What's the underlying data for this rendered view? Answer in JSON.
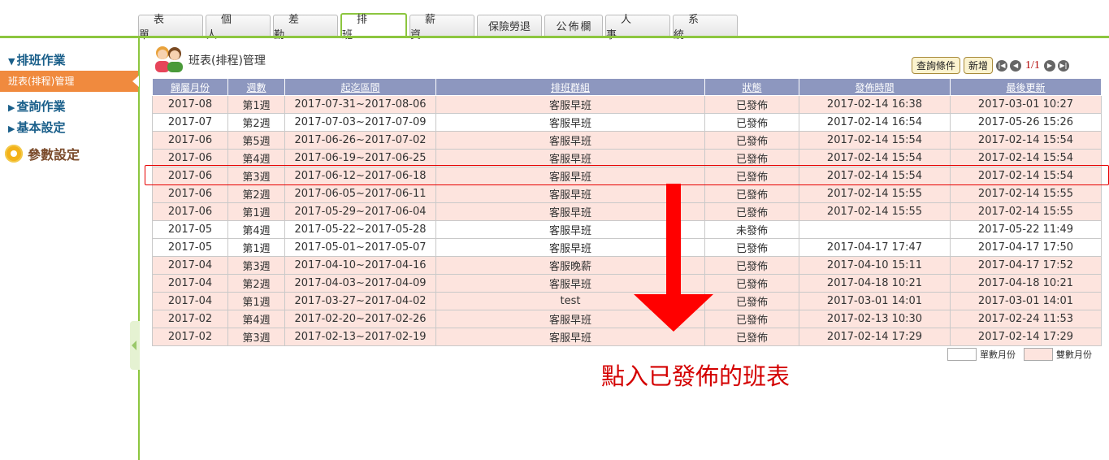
{
  "tabs": [
    "表單",
    "個人",
    "差勤",
    "排班",
    "薪資",
    "保險勞退",
    "公佈欄",
    "人事",
    "系統"
  ],
  "sidebar": {
    "section1": "排班作業",
    "active_item": "班表(排程)管理",
    "section2": "查詢作業",
    "section3": "基本設定",
    "gear_item": "參數設定"
  },
  "page": {
    "title": "班表(排程)管理"
  },
  "toolbar": {
    "query_label": "查詢條件",
    "add_label": "新增",
    "pager": "1/1"
  },
  "table": {
    "columns": [
      "歸屬月份",
      "週數",
      "起迄區間",
      "排班群組",
      "狀態",
      "發佈時間",
      "最後更新"
    ],
    "rows": [
      [
        "2017-08",
        "第1週",
        "2017-07-31~2017-08-06",
        "客服早班",
        "已發佈",
        "2017-02-14 16:38",
        "2017-03-01 10:27"
      ],
      [
        "2017-07",
        "第2週",
        "2017-07-03~2017-07-09",
        "客服早班",
        "已發佈",
        "2017-02-14 16:54",
        "2017-05-26 15:26"
      ],
      [
        "2017-06",
        "第5週",
        "2017-06-26~2017-07-02",
        "客服早班",
        "已發佈",
        "2017-02-14 15:54",
        "2017-02-14 15:54"
      ],
      [
        "2017-06",
        "第4週",
        "2017-06-19~2017-06-25",
        "客服早班",
        "已發佈",
        "2017-02-14 15:54",
        "2017-02-14 15:54"
      ],
      [
        "2017-06",
        "第3週",
        "2017-06-12~2017-06-18",
        "客服早班",
        "已發佈",
        "2017-02-14 15:54",
        "2017-02-14 15:54"
      ],
      [
        "2017-06",
        "第2週",
        "2017-06-05~2017-06-11",
        "客服早班",
        "已發佈",
        "2017-02-14 15:55",
        "2017-02-14 15:55"
      ],
      [
        "2017-06",
        "第1週",
        "2017-05-29~2017-06-04",
        "客服早班",
        "已發佈",
        "2017-02-14 15:55",
        "2017-02-14 15:55"
      ],
      [
        "2017-05",
        "第4週",
        "2017-05-22~2017-05-28",
        "客服早班",
        "未發佈",
        "",
        "2017-05-22 11:49"
      ],
      [
        "2017-05",
        "第1週",
        "2017-05-01~2017-05-07",
        "客服早班",
        "已發佈",
        "2017-04-17 17:47",
        "2017-04-17 17:50"
      ],
      [
        "2017-04",
        "第3週",
        "2017-04-10~2017-04-16",
        "客服晚薪",
        "已發佈",
        "2017-04-10 15:11",
        "2017-04-17 17:52"
      ],
      [
        "2017-04",
        "第2週",
        "2017-04-03~2017-04-09",
        "客服早班",
        "已發佈",
        "2017-04-18 10:21",
        "2017-04-18 10:21"
      ],
      [
        "2017-04",
        "第1週",
        "2017-03-27~2017-04-02",
        "test",
        "已發佈",
        "2017-03-01 14:01",
        "2017-03-01 14:01"
      ],
      [
        "2017-02",
        "第4週",
        "2017-02-20~2017-02-26",
        "客服早班",
        "已發佈",
        "2017-02-13 10:30",
        "2017-02-24 11:53"
      ],
      [
        "2017-02",
        "第3週",
        "2017-02-13~2017-02-19",
        "客服早班",
        "已發佈",
        "2017-02-14 17:29",
        "2017-02-14 17:29"
      ]
    ]
  },
  "legend": {
    "odd": "單數月份",
    "even": "雙數月份"
  },
  "annotation": {
    "text": "點入已發佈的班表"
  },
  "colors": {
    "accent_green": "#8cc63f",
    "active_orange": "#f08a3e",
    "header_blue": "#8d97bf",
    "even_month_row": "#fde4de",
    "published": "#1a1ab4",
    "unpublished": "#d40000"
  }
}
